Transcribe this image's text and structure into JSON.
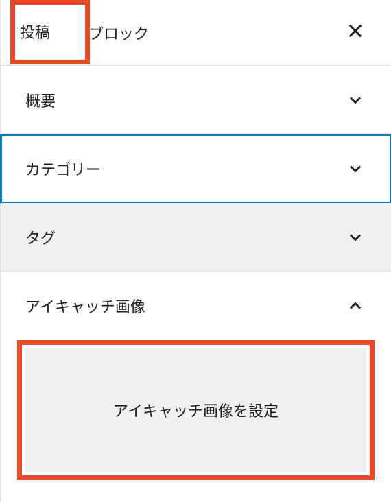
{
  "tabs": {
    "post": "投稿",
    "block": "ブロック"
  },
  "sections": {
    "summary": "概要",
    "categories": "カテゴリー",
    "tags": "タグ",
    "eyecatch": "アイキャッチ画像"
  },
  "eyecatch": {
    "button_label": "アイキャッチ画像を設定"
  }
}
